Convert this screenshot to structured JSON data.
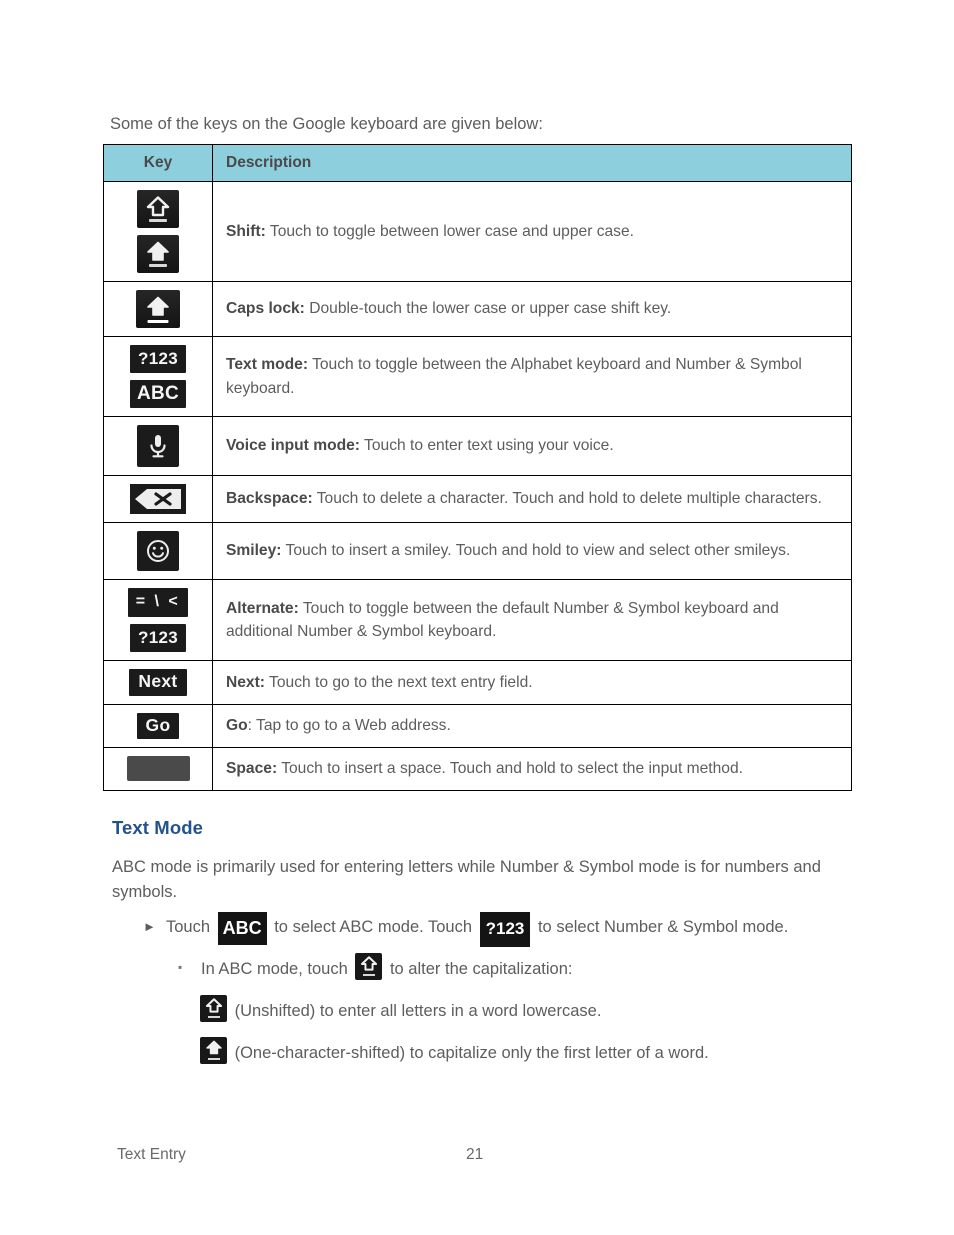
{
  "document": {
    "intro_text": "Some of the keys on the Google keyboard are given below:"
  },
  "table": {
    "headers": {
      "key": "Key",
      "description": "Description"
    },
    "header_bg_color": "#8ecfdd",
    "rows": [
      {
        "icons": [
          "shift-unshifted-key",
          "shift-shifted-key"
        ],
        "term": "Shift:",
        "text": " Touch to toggle between lower case and upper case."
      },
      {
        "icons": [
          "caps-lock-key"
        ],
        "term": "Caps lock:",
        "text": " Double-touch the lower case or upper case shift key."
      },
      {
        "icons": [
          "text-mode-123-key",
          "text-mode-abc-key"
        ],
        "key_labels": {
          "num": "?123",
          "abc": "ABC"
        },
        "term": "Text mode:",
        "text": " Touch to toggle between the Alphabet keyboard and Number & Symbol keyboard."
      },
      {
        "icons": [
          "voice-input-mic-key"
        ],
        "term": "Voice input mode:",
        "text": " Touch to enter text using your voice."
      },
      {
        "icons": [
          "backspace-key"
        ],
        "term": "Backspace:",
        "text": " Touch to delete a character. Touch and hold to delete multiple characters."
      },
      {
        "icons": [
          "smiley-key"
        ],
        "term": "Smiley:",
        "text": " Touch to insert a smiley. Touch and hold to view and select other smileys."
      },
      {
        "icons": [
          "alternate-symbols-key",
          "alternate-123-key"
        ],
        "key_labels": {
          "sym": "= \\ <",
          "num": "?123"
        },
        "term": "Alternate:",
        "text": " Touch to toggle between the default Number & Symbol keyboard and additional Number & Symbol keyboard."
      },
      {
        "icons": [
          "next-key"
        ],
        "key_labels": {
          "next": "Next"
        },
        "term": "Next:",
        "text": " Touch to go to the next text entry field."
      },
      {
        "icons": [
          "go-key"
        ],
        "key_labels": {
          "go": "Go"
        },
        "term": "Go",
        "text": ": Tap to go to a Web address."
      },
      {
        "icons": [
          "space-bar-key"
        ],
        "term": "Space:",
        "text": " Touch to insert a space. Touch and hold to select the input method."
      }
    ]
  },
  "text_mode_section": {
    "heading": "Text Mode",
    "heading_color": "#23538d",
    "paragraph": "ABC mode is primarily used for entering letters while Number & Symbol mode is for numbers and symbols.",
    "bullet_level1": {
      "marker": "►",
      "part1": "Touch",
      "chip1": "ABC",
      "part2": "to select ABC mode. Touch",
      "chip2": "?123",
      "part3": "to select Number & Symbol mode."
    },
    "bullet_level2": {
      "marker": "▪",
      "part1": "In ABC mode, touch",
      "part2": "to alter the capitalization:"
    },
    "sub_lines": [
      {
        "icon": "shift-unshifted-key",
        "text": "(Unshifted) to enter all letters in a word lowercase."
      },
      {
        "icon": "shift-shifted-key",
        "text": "(One-character-shifted) to capitalize only the first letter of a word."
      }
    ]
  },
  "footer": {
    "chapter": "Text Entry",
    "page_number": "21"
  }
}
